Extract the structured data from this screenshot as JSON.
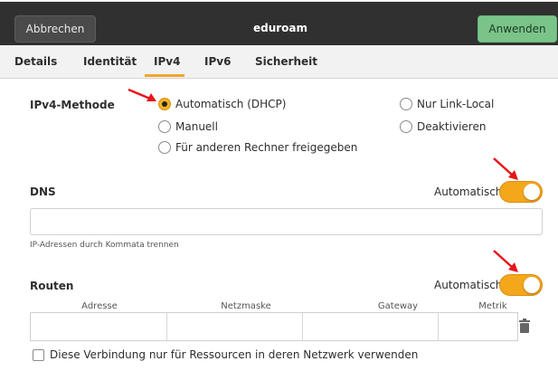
{
  "header": {
    "cancel_label": "Abbrechen",
    "title": "eduroam",
    "apply_label": "Anwenden"
  },
  "tabs": [
    {
      "label": "Details"
    },
    {
      "label": "Identität"
    },
    {
      "label": "IPv4",
      "active": true
    },
    {
      "label": "IPv6"
    },
    {
      "label": "Sicherheit"
    }
  ],
  "ipv4": {
    "method_label": "IPv4-Methode",
    "options": [
      {
        "label": "Automatisch (DHCP)",
        "checked": true
      },
      {
        "label": "Manuell",
        "checked": false
      },
      {
        "label": "Für anderen Rechner freigegeben",
        "checked": false
      },
      {
        "label": "Nur Link-Local",
        "checked": false
      },
      {
        "label": "Deaktivieren",
        "checked": false
      }
    ]
  },
  "dns": {
    "label": "DNS",
    "auto_label": "Automatisch",
    "auto_on": true,
    "value": "",
    "hint": "IP-Adressen durch Kommata trennen"
  },
  "routes": {
    "label": "Routen",
    "auto_label": "Automatisch",
    "auto_on": true,
    "columns": [
      "Adresse",
      "Netzmaske",
      "Gateway",
      "Metrik"
    ]
  },
  "restrict": {
    "label": "Diese Verbindung nur für Ressourcen in deren Netzwerk verwenden",
    "checked": false
  },
  "colors": {
    "accent": "#f5a71c",
    "apply": "#7ac48a",
    "titlebar": "#303030",
    "annotation_arrow": "#e8141a"
  }
}
